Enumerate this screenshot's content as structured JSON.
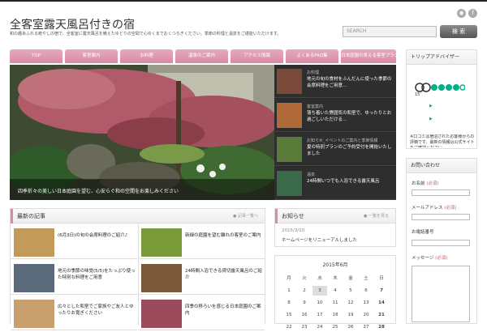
{
  "header": {
    "site_title": "全客室露天風呂付きの宿",
    "site_desc": "和の趣あふれる癒やしの宿で、全客室に露天風呂を備えたゆとりの空間で心ゆくまでおくつろぎください。季節の料理と温泉をご堪能いただけます。",
    "search_placeholder": "SEARCH",
    "search_button": "検 索",
    "social": [
      {
        "icon": "rss-icon",
        "glyph": "◉"
      },
      {
        "icon": "facebook-icon",
        "glyph": "f"
      }
    ]
  },
  "nav": [
    "TOP",
    "客室案内",
    "お料理",
    "温泉のご案内",
    "アクセス情報",
    "よくあるFAQ集",
    "日本庭園の見える客室プランのご紹介"
  ],
  "slider": {
    "caption": "四季折々の美しい日本庭園を望む、心安らぐ和の空間をお楽しみください",
    "thumbs": [
      {
        "cat": "お料理",
        "title": "地元の旬の食材をふんだんに使った季節の会席料理をご用意…",
        "swatch": "#7a4a3a"
      },
      {
        "cat": "客室案内",
        "title": "落ち着いた雰囲気の和室で、ゆったりとお過ごしいただける…",
        "swatch": "#b06a3a"
      },
      {
        "cat": "お知らせ_イベントのご案内と季節情報",
        "title": "夏の特別プランのご予約受付を開始いたしました",
        "swatch": "#5a7a3a"
      },
      {
        "cat": "温泉",
        "title": "24時間いつでも入浴できる露天風呂",
        "swatch": "#3a6a4a"
      }
    ]
  },
  "latest": {
    "title": "最新の記事",
    "more": "記事一覧へ",
    "posts": [
      {
        "title": "(6月3日)の旬の会席料理のご紹介♪",
        "swatch": "#c49a5a"
      },
      {
        "title": "新緑の庭園を望む離れの客室のご案内",
        "swatch": "#7a9a3a"
      },
      {
        "title": "地元の季節の味覚(5/5)をたっぷり使った特別な料理をご用意",
        "swatch": "#5a6a7a"
      },
      {
        "title": "24時間入浴できる貸切露天風呂のご紹介",
        "swatch": "#7a5a3a"
      },
      {
        "title": "広々とした和室でご家族やご友人とゆったりお寛ぎください",
        "swatch": "#c8a070"
      },
      {
        "title": "四季の移ろいを感じる日本庭園のご案内",
        "swatch": "#9a4a5a"
      }
    ]
  },
  "news": {
    "title": "お知らせ",
    "more": "一覧を見る",
    "date": "2015/3/10",
    "item": "ホームページをリニューアルしました"
  },
  "calendar": {
    "title": "2015年6月",
    "weekdays": [
      "月",
      "火",
      "水",
      "木",
      "金",
      "土",
      "日"
    ],
    "rows": [
      [
        "1",
        "2",
        "3",
        "4",
        "5",
        "6",
        "7"
      ],
      [
        "8",
        "9",
        "10",
        "11",
        "12",
        "13",
        "14"
      ],
      [
        "15",
        "16",
        "17",
        "18",
        "19",
        "20",
        "21"
      ],
      [
        "22",
        "23",
        "24",
        "25",
        "26",
        "27",
        "28"
      ]
    ]
  },
  "sidebar": {
    "widget1_title": "トリップアドバイザー",
    "review_count": "15",
    "links": [
      "▶",
      "▶"
    ],
    "widget1_text": "※口コミは宿泊されたお客様からの評価です。最新の情報は公式サイトをご確認ください。",
    "widget2_title": "お問い合わせ",
    "form": [
      {
        "label": "お名前",
        "req": "(必須)"
      },
      {
        "label": "メールアドレス",
        "req": "(必須)"
      },
      {
        "label": "お電話番号",
        "req": ""
      },
      {
        "label": "メッセージ",
        "req": "(必須)"
      }
    ]
  },
  "colors": {
    "accent": "#d98aa7",
    "nav": "#e6a9c0",
    "dark": "#2a2a2a"
  }
}
